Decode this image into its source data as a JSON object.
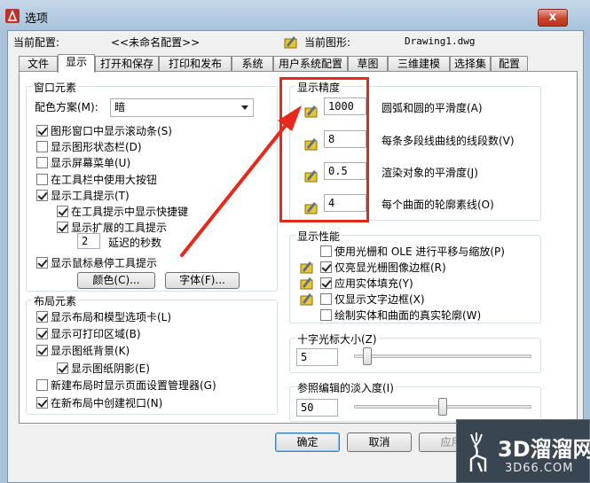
{
  "window": {
    "title": "选项",
    "close_label": "x"
  },
  "config": {
    "profile_label": "当前配置:",
    "profile_value": "<<未命名配置>>",
    "drawing_label": "当前图形:",
    "drawing_value": "Drawing1.dwg"
  },
  "tabs": [
    "文件",
    "显示",
    "打开和保存",
    "打印和发布",
    "系统",
    "用户系统配置",
    "草图",
    "三维建模",
    "选择集",
    "配置"
  ],
  "window_elements": {
    "title": "窗口元素",
    "color_scheme_label": "配色方案(M):",
    "color_scheme_value": "暗",
    "options": [
      {
        "label": "图形窗口中显示滚动条(S)",
        "checked": true
      },
      {
        "label": "显示图形状态栏(D)",
        "checked": false
      },
      {
        "label": "显示屏幕菜单(U)",
        "checked": false
      },
      {
        "label": "在工具栏中使用大按钮",
        "checked": false
      },
      {
        "label": "显示工具提示(T)",
        "checked": true
      },
      {
        "label": "在工具提示中显示快捷键",
        "checked": true
      },
      {
        "label": "显示扩展的工具提示",
        "checked": true
      }
    ],
    "delay_value": "2",
    "delay_label": "延迟的秒数",
    "rollover_label": "显示鼠标悬停工具提示",
    "rollover_checked": true,
    "colors_button": "颜色(C)...",
    "fonts_button": "字体(F)..."
  },
  "layout_elements": {
    "title": "布局元素",
    "options": [
      {
        "label": "显示布局和模型选项卡(L)",
        "checked": true
      },
      {
        "label": "显示可打印区域(B)",
        "checked": true
      },
      {
        "label": "显示图纸背景(K)",
        "checked": true
      },
      {
        "label": "显示图纸阴影(E)",
        "checked": true
      },
      {
        "label": "新建布局时显示页面设置管理器(G)",
        "checked": false
      },
      {
        "label": "在新布局中创建视口(N)",
        "checked": true
      }
    ]
  },
  "resolution": {
    "title": "显示精度",
    "items": [
      {
        "value": "1000",
        "label": "圆弧和圆的平滑度(A)"
      },
      {
        "value": "8",
        "label": "每条多段线曲线的线段数(V)"
      },
      {
        "value": "0.5",
        "label": "渲染对象的平滑度(J)"
      },
      {
        "value": "4",
        "label": "每个曲面的轮廓素线(O)"
      }
    ]
  },
  "performance": {
    "title": "显示性能",
    "options": [
      {
        "label": "使用光栅和 OLE 进行平移与缩放(P)",
        "checked": false
      },
      {
        "label": "仅亮显光栅图像边框(R)",
        "checked": true
      },
      {
        "label": "应用实体填充(Y)",
        "checked": true
      },
      {
        "label": "仅显示文字边框(X)",
        "checked": false
      },
      {
        "label": "绘制实体和曲面的真实轮廓(W)",
        "checked": false
      }
    ]
  },
  "crosshair": {
    "title": "十字光标大小(Z)",
    "value": "5",
    "fraction": 0.05
  },
  "xref_fade": {
    "title": "参照编辑的淡入度(I)",
    "value": "50",
    "fraction": 0.5
  },
  "buttons": {
    "ok": "确定",
    "cancel": "取消",
    "apply": "应用"
  },
  "watermark": {
    "brand": "3D溜溜网",
    "url": "3D66.COM"
  },
  "colors": {
    "highlight_box": "#e8281b",
    "arrow": "#e8281b",
    "title_bg": "#a9c2d9"
  }
}
